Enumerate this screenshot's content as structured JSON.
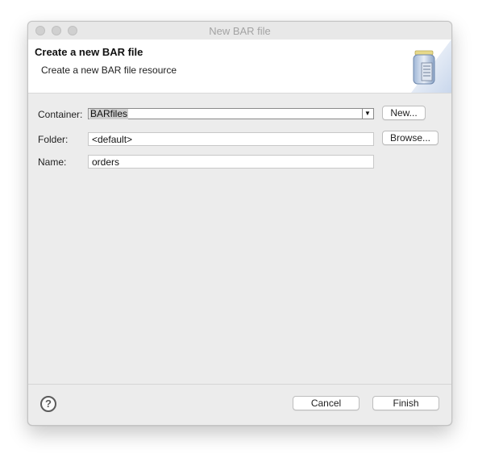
{
  "window": {
    "title": "New BAR file"
  },
  "header": {
    "title": "Create a new BAR file",
    "subtitle": "Create a new BAR file resource",
    "banner_icon": "bar-file-jar-icon"
  },
  "form": {
    "container_label": "Container:",
    "container_value": "BARfiles",
    "new_button": "New...",
    "folder_label": "Folder:",
    "folder_value": "<default>",
    "browse_button": "Browse...",
    "name_label": "Name:",
    "name_value": "orders"
  },
  "footer": {
    "help_icon": "?",
    "cancel_button": "Cancel",
    "finish_button": "Finish"
  }
}
